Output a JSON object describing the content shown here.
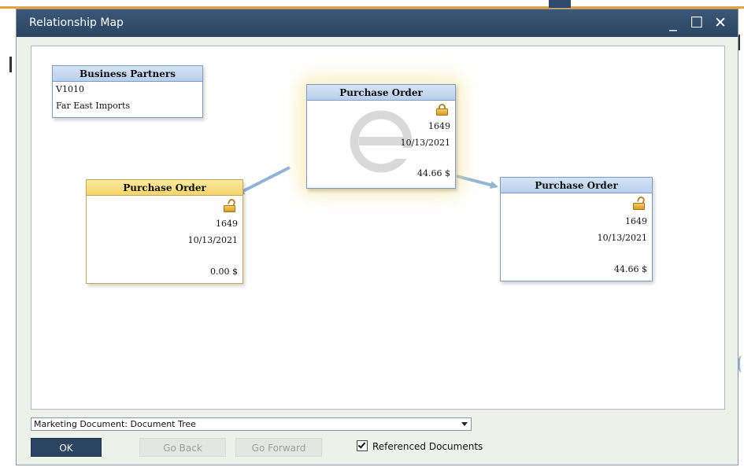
{
  "window": {
    "title": "Relationship Map",
    "minimize_glyph": "_",
    "maximize_glyph": "☐",
    "close_glyph": "✕"
  },
  "nodes": {
    "business_partners": {
      "header": "Business Partners",
      "code": "V1010",
      "name": "Far East Imports"
    },
    "center": {
      "header": "Purchase Order",
      "number": "1649",
      "date": "10/13/2021",
      "amount": "44.66 $",
      "lock_icon": "lock-icon"
    },
    "left": {
      "header": "Purchase Order",
      "number": "1649",
      "date": "10/13/2021",
      "amount": "0.00 $",
      "lock_icon": "unlock-icon"
    },
    "right": {
      "header": "Purchase Order",
      "number": "1649",
      "date": "10/13/2021",
      "amount": "44.66 $",
      "lock_icon": "unlock-icon"
    }
  },
  "controls": {
    "view_select": "Marketing Document: Document Tree",
    "ok_label": "OK",
    "back_label": "Go Back",
    "forward_label": "Go Forward",
    "referenced_label": "Referenced Documents",
    "referenced_checked": true
  },
  "colors": {
    "titlebar": "#2b4462",
    "node_header_blue": "#c5d8f0",
    "node_header_yellow": "#f6dc7a",
    "connector": "#8fb3d9"
  }
}
